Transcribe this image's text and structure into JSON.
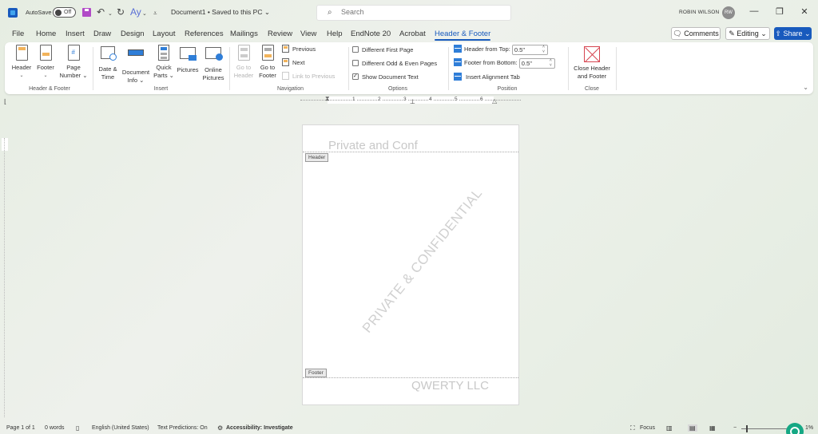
{
  "titlebar": {
    "autosave_label": "AutoSave",
    "autosave_state": "Off",
    "document_title": "Document1 • Saved to this PC ⌄",
    "search_placeholder": "Search",
    "user_name": "ROBIN WILSON",
    "user_initials": "RW",
    "minimize": "—",
    "restore": "❐",
    "close": "✕"
  },
  "tabs": [
    {
      "label": "File"
    },
    {
      "label": "Home"
    },
    {
      "label": "Insert"
    },
    {
      "label": "Draw"
    },
    {
      "label": "Design"
    },
    {
      "label": "Layout"
    },
    {
      "label": "References"
    },
    {
      "label": "Mailings"
    },
    {
      "label": "Review"
    },
    {
      "label": "View"
    },
    {
      "label": "Help"
    },
    {
      "label": "EndNote 20"
    },
    {
      "label": "Acrobat"
    },
    {
      "label": "Header & Footer",
      "active": true
    }
  ],
  "actions": {
    "comments": "🗨 Comments",
    "editing": "✎ Editing ⌄",
    "share": "⇪ Share ⌄"
  },
  "ribbon": {
    "header_footer": {
      "label": "Header & Footer",
      "header": "Header",
      "footer": "Footer",
      "page_number_1": "Page",
      "page_number_2": "Number ⌄"
    },
    "insert": {
      "label": "Insert",
      "date_time_1": "Date &",
      "date_time_2": "Time",
      "doc_info_1": "Document",
      "doc_info_2": "Info ⌄",
      "quick_parts_1": "Quick",
      "quick_parts_2": "Parts ⌄",
      "pictures": "Pictures",
      "online_pictures_1": "Online",
      "online_pictures_2": "Pictures"
    },
    "navigation": {
      "label": "Navigation",
      "go_to_header_1": "Go to",
      "go_to_header_2": "Header",
      "go_to_footer_1": "Go to",
      "go_to_footer_2": "Footer",
      "previous": "Previous",
      "next": "Next",
      "link_to_previous": "Link to Previous"
    },
    "options": {
      "label": "Options",
      "different_first_page": "Different First Page",
      "different_odd_even": "Different Odd & Even Pages",
      "show_document_text": "Show Document Text",
      "different_first_page_checked": false,
      "different_odd_even_checked": false,
      "show_document_text_checked": true
    },
    "position": {
      "label": "Position",
      "header_from_top": "Header from Top:",
      "header_from_top_value": "0.5\"",
      "footer_from_bottom": "Footer from Bottom:",
      "footer_from_bottom_value": "0.5\"",
      "insert_alignment_tab": "Insert Alignment Tab"
    },
    "close": {
      "label": "Close",
      "close_1": "Close Header",
      "close_2": "and Footer"
    }
  },
  "ruler": {
    "numbers": [
      "1",
      "2",
      "3",
      "4",
      "5",
      "6"
    ]
  },
  "document": {
    "header_text": "Private and Conf",
    "header_tag": "Header",
    "watermark": "PRIVATE & CONFIDENTIAL",
    "footer_tag": "Footer",
    "footer_text": "QWERTY LLC"
  },
  "statusbar": {
    "page": "Page 1 of 1",
    "words": "0 words",
    "language": "English (United States)",
    "text_predictions": "Text Predictions: On",
    "accessibility": "Accessibility: Investigate",
    "focus": "Focus",
    "zoom": "1%"
  }
}
